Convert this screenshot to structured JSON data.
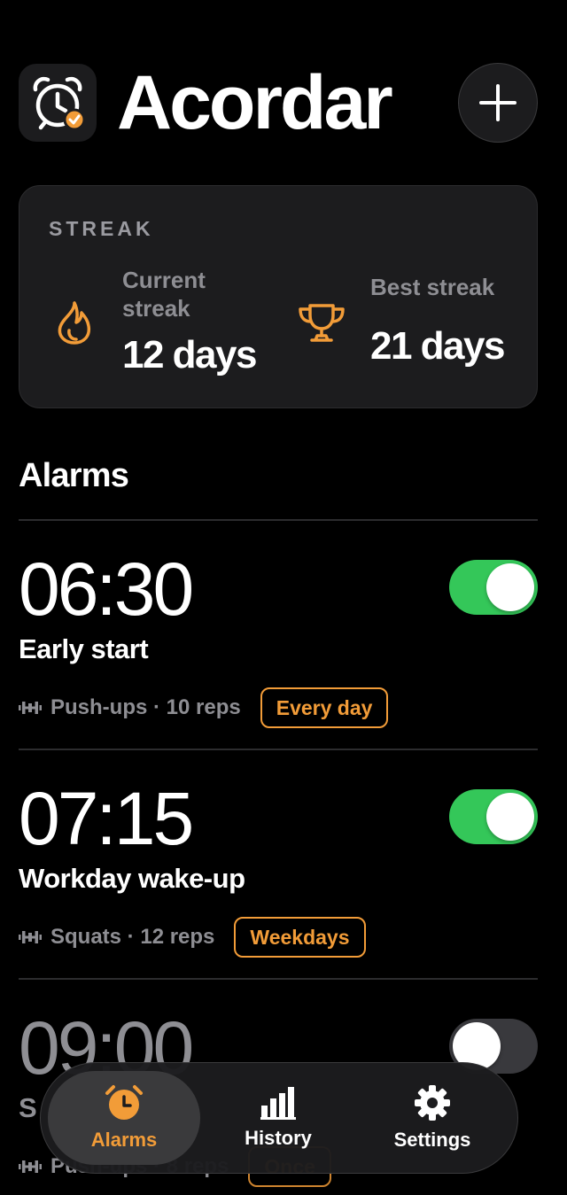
{
  "app": {
    "title": "Acordar",
    "icon": "alarm-clock-check-icon",
    "add_button_icon": "plus-icon"
  },
  "streak": {
    "label": "STREAK",
    "current": {
      "label": "Current streak",
      "value": "12 days",
      "icon": "flame-icon"
    },
    "best": {
      "label": "Best streak",
      "value": "21 days",
      "icon": "trophy-icon"
    }
  },
  "alarms_section": {
    "title": "Alarms",
    "items": [
      {
        "time": "06:30",
        "name": "Early start",
        "exercise": "Push-ups · 10 reps",
        "schedule": "Every day",
        "enabled": true
      },
      {
        "time": "07:15",
        "name": "Workday wake-up",
        "exercise": "Squats · 12 reps",
        "schedule": "Weekdays",
        "enabled": true
      },
      {
        "time": "09:00",
        "name": "S",
        "exercise": "Push-ups · 8 reps",
        "schedule": "Once",
        "enabled": false
      }
    ]
  },
  "tabbar": {
    "tabs": [
      {
        "label": "Alarms",
        "icon": "alarm-clock-icon",
        "active": true
      },
      {
        "label": "History",
        "icon": "bar-chart-icon",
        "active": false
      },
      {
        "label": "Settings",
        "icon": "gear-icon",
        "active": false
      }
    ]
  },
  "colors": {
    "accent": "#f29c38",
    "toggle_on": "#34c759",
    "toggle_off": "#39393d",
    "card": "#1c1c1e",
    "secondary_text": "#8e8e93"
  }
}
